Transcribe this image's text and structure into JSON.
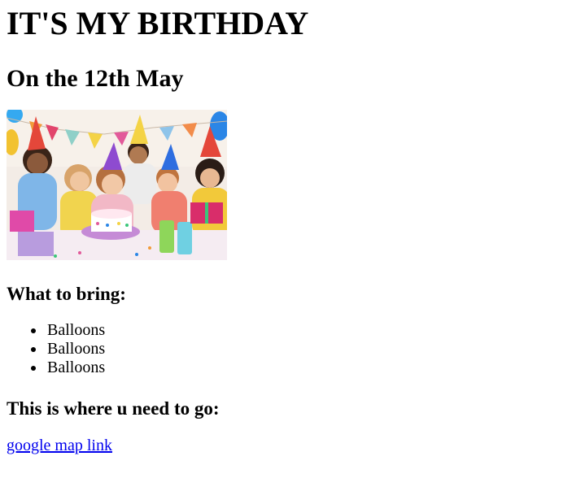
{
  "page": {
    "title": "IT'S MY BIRTHDAY",
    "subtitle": "On the 12th May",
    "photo_icon": "birthday-party-photo",
    "bring_heading": "What to bring:",
    "bring_items": [
      "Balloons",
      "Balloons",
      "Balloons"
    ],
    "go_heading": "This is where u need to go:",
    "map_link_text": "google map link"
  },
  "colors": {
    "link": "#0000ee",
    "text": "#000000",
    "background": "#ffffff"
  }
}
